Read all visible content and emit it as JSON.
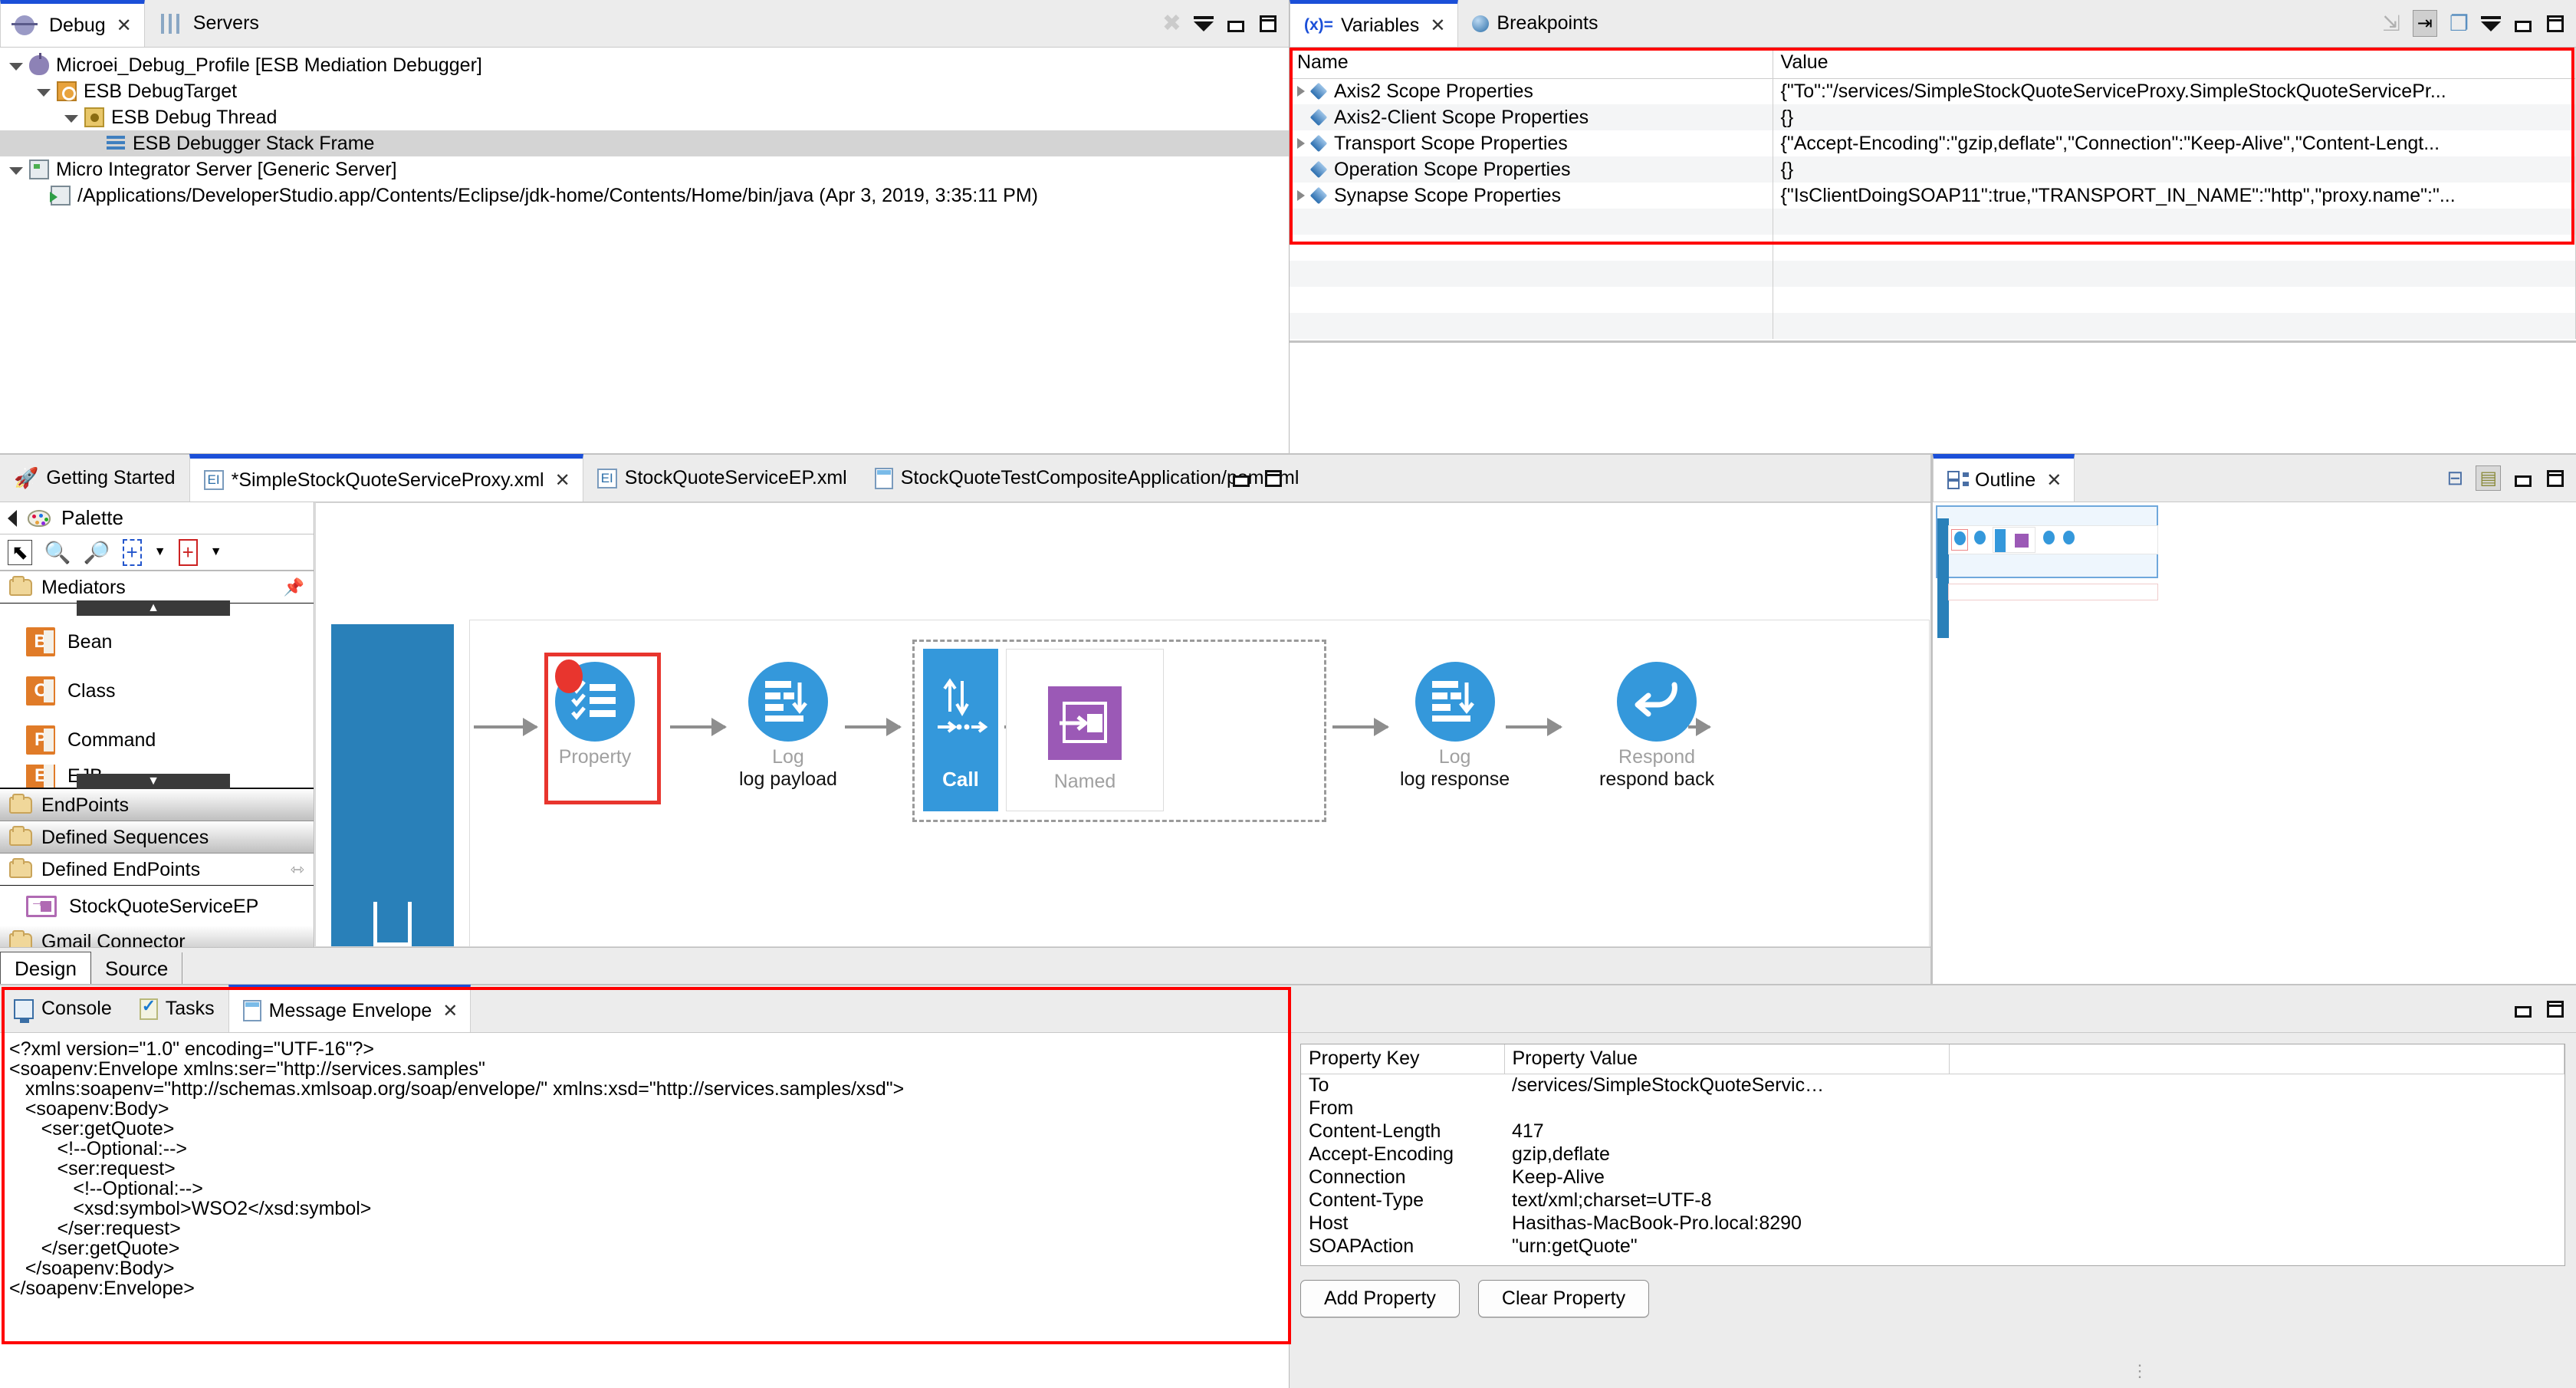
{
  "debug_view": {
    "tabs": [
      {
        "label": "Debug",
        "icon": "bug-icon",
        "active": true,
        "closeable": true
      },
      {
        "label": "Servers",
        "icon": "servers-icon",
        "active": false,
        "closeable": false
      }
    ],
    "toolbar_icons": [
      "disconnect-icon",
      "view-menu-icon",
      "minimize-icon",
      "maximize-icon"
    ],
    "tree": [
      {
        "label": "Microei_Debug_Profile [ESB Mediation Debugger]",
        "indent": 0,
        "twisty": "open",
        "icon": "debug-launch-icon",
        "selected": false
      },
      {
        "label": "ESB DebugTarget",
        "indent": 1,
        "twisty": "open",
        "icon": "debug-target-icon",
        "selected": false
      },
      {
        "label": "ESB Debug Thread",
        "indent": 2,
        "twisty": "open",
        "icon": "thread-icon",
        "selected": false
      },
      {
        "label": "ESB Debugger Stack Frame",
        "indent": 3,
        "twisty": "none",
        "icon": "stack-frame-icon",
        "selected": true
      },
      {
        "label": "Micro Integrator Server [Generic Server]",
        "indent": 0,
        "twisty": "open",
        "icon": "server-icon",
        "selected": false
      },
      {
        "label": "/Applications/DeveloperStudio.app/Contents/Eclipse/jdk-home/Contents/Home/bin/java (Apr 3, 2019, 3:35:11 PM)",
        "indent": 1,
        "twisty": "none",
        "icon": "java-process-icon",
        "selected": false
      }
    ]
  },
  "variables_view": {
    "tabs": [
      {
        "label": "Variables",
        "icon": "variables-icon",
        "active": true,
        "closeable": true
      },
      {
        "label": "Breakpoints",
        "icon": "breakpoint-icon",
        "active": false,
        "closeable": false
      }
    ],
    "toolbar_icons": [
      "collapse-all-icon",
      "show-logical-structure-icon",
      "layout-icon",
      "view-menu-icon",
      "minimize-icon",
      "maximize-icon"
    ],
    "columns": [
      "Name",
      "Value"
    ],
    "rows": [
      {
        "expandable": true,
        "name": "Axis2 Scope Properties",
        "value": "{\"To\":\"/services/SimpleStockQuoteServiceProxy.SimpleStockQuoteServicePr..."
      },
      {
        "expandable": false,
        "name": "Axis2-Client Scope Properties",
        "value": "{}"
      },
      {
        "expandable": true,
        "name": "Transport Scope Properties",
        "value": "{\"Accept-Encoding\":\"gzip,deflate\",\"Connection\":\"Keep-Alive\",\"Content-Lengt..."
      },
      {
        "expandable": false,
        "name": "Operation Scope Properties",
        "value": "{}"
      },
      {
        "expandable": true,
        "name": "Synapse Scope Properties",
        "value": "{\"IsClientDoingSOAP11\":true,\"TRANSPORT_IN_NAME\":\"http\",\"proxy.name\":\"..."
      }
    ]
  },
  "editor": {
    "tabs": [
      {
        "label": "Getting Started",
        "icon": "getting-started-icon",
        "active": false,
        "closeable": false
      },
      {
        "label": "*SimpleStockQuoteServiceProxy.xml",
        "icon": "esb-xml-icon",
        "active": true,
        "closeable": true
      },
      {
        "label": "StockQuoteServiceEP.xml",
        "icon": "esb-xml-icon",
        "active": false,
        "closeable": false
      },
      {
        "label": "StockQuoteTestCompositeApplication/pom.xml",
        "icon": "pom-icon",
        "active": false,
        "closeable": false
      }
    ],
    "toolbar_icons": [
      "minimize-icon",
      "maximize-icon"
    ],
    "bottom_tabs": [
      {
        "label": "Design",
        "active": true
      },
      {
        "label": "Source",
        "active": false
      }
    ]
  },
  "palette": {
    "title": "Palette",
    "back_icon": "back-arrow-icon",
    "tools": [
      "select-tool-icon",
      "zoom-in-icon",
      "zoom-out-icon",
      "marquee-icon",
      "marquee-dropdown-icon",
      "create-connection-icon",
      "create-connection-dropdown-icon"
    ],
    "sections": [
      {
        "label": "Mediators",
        "open": true,
        "pin": true,
        "items": [
          {
            "label": "Bean",
            "glyph": "B",
            "icon": "bean-mediator-icon"
          },
          {
            "label": "Class",
            "glyph": "C",
            "icon": "class-mediator-icon"
          },
          {
            "label": "Command",
            "glyph": "P",
            "icon": "command-mediator-icon"
          },
          {
            "label": "EJB",
            "glyph": "E",
            "icon": "ejb-mediator-icon"
          }
        ]
      },
      {
        "label": "EndPoints",
        "open": false,
        "items": []
      },
      {
        "label": "Defined Sequences",
        "open": false,
        "items": []
      },
      {
        "label": "Defined EndPoints",
        "open": true,
        "collapse_icon": "collapse-icon",
        "items": [
          {
            "label": "StockQuoteServiceEP",
            "icon": "endpoint-icon"
          }
        ]
      },
      {
        "label": "Gmail Connector",
        "open": false,
        "items": []
      }
    ],
    "scroll_up": "▲",
    "scroll_down": "▼"
  },
  "diagram": {
    "nodes": [
      {
        "name": "property-mediator",
        "label": "Property",
        "sublabel": "",
        "shape": "circle",
        "icon": "checklist-icon",
        "highlighted": true,
        "breakpoint": true
      },
      {
        "name": "log-mediator-1",
        "label": "Log",
        "sublabel": "log payload",
        "shape": "circle",
        "icon": "log-icon",
        "highlighted": false,
        "breakpoint": false
      },
      {
        "name": "call-mediator",
        "label": "Call",
        "sublabel": "",
        "shape": "rect",
        "icon": "call-icon",
        "highlighted": false,
        "breakpoint": false
      },
      {
        "name": "named-endpoint",
        "label": "Named",
        "sublabel": "",
        "shape": "square",
        "icon": "endpoint-icon",
        "highlighted": false,
        "breakpoint": false
      },
      {
        "name": "log-mediator-2",
        "label": "Log",
        "sublabel": "log response",
        "shape": "circle",
        "icon": "log-icon",
        "highlighted": false,
        "breakpoint": false
      },
      {
        "name": "respond-mediator",
        "label": "Respond",
        "sublabel": "respond back",
        "shape": "circle",
        "icon": "respond-icon",
        "highlighted": false,
        "breakpoint": false
      }
    ]
  },
  "outline": {
    "tabs": [
      {
        "label": "Outline",
        "icon": "outline-icon",
        "active": true,
        "closeable": true
      }
    ],
    "toolbar_icons": [
      "tree-view-icon",
      "thumbnail-view-icon",
      "minimize-icon",
      "maximize-icon"
    ]
  },
  "bottom": {
    "tabs": [
      {
        "label": "Console",
        "icon": "console-icon",
        "active": false,
        "closeable": false
      },
      {
        "label": "Tasks",
        "icon": "tasks-icon",
        "active": false,
        "closeable": false
      },
      {
        "label": "Message Envelope",
        "icon": "envelope-icon",
        "active": true,
        "closeable": true
      }
    ],
    "toolbar_icons": [
      "minimize-icon",
      "maximize-icon"
    ],
    "envelope_xml": "<?xml version=\"1.0\" encoding=\"UTF-16\"?>\n<soapenv:Envelope xmlns:ser=\"http://services.samples\"\n   xmlns:soapenv=\"http://schemas.xmlsoap.org/soap/envelope/\" xmlns:xsd=\"http://services.samples/xsd\">\n   <soapenv:Body>\n      <ser:getQuote>\n         <!--Optional:-->\n         <ser:request>\n            <!--Optional:-->\n            <xsd:symbol>WSO2</xsd:symbol>\n         </ser:request>\n      </ser:getQuote>\n   </soapenv:Body>\n</soapenv:Envelope>",
    "property_table": {
      "columns": [
        "Property Key",
        "Property Value"
      ],
      "rows": [
        {
          "key": "To",
          "value": "/services/SimpleStockQuoteServic…"
        },
        {
          "key": "From",
          "value": ""
        },
        {
          "key": "Content-Length",
          "value": "417"
        },
        {
          "key": "Accept-Encoding",
          "value": "gzip,deflate"
        },
        {
          "key": "Connection",
          "value": "Keep-Alive"
        },
        {
          "key": "Content-Type",
          "value": "text/xml;charset=UTF-8"
        },
        {
          "key": "Host",
          "value": "Hasithas-MacBook-Pro.local:8290"
        },
        {
          "key": "SOAPAction",
          "value": "\"urn:getQuote\""
        }
      ]
    },
    "buttons": [
      {
        "label": "Add Property",
        "name": "add-property-button"
      },
      {
        "label": "Clear Property",
        "name": "clear-property-button"
      }
    ]
  },
  "colors": {
    "accent_blue": "#3498db",
    "call_blue": "#2980b9",
    "purple": "#9b59b6",
    "highlight_red": "#e8352e",
    "tab_active_underline": "#1b4fd8",
    "mediator_orange": "#e07b28"
  }
}
